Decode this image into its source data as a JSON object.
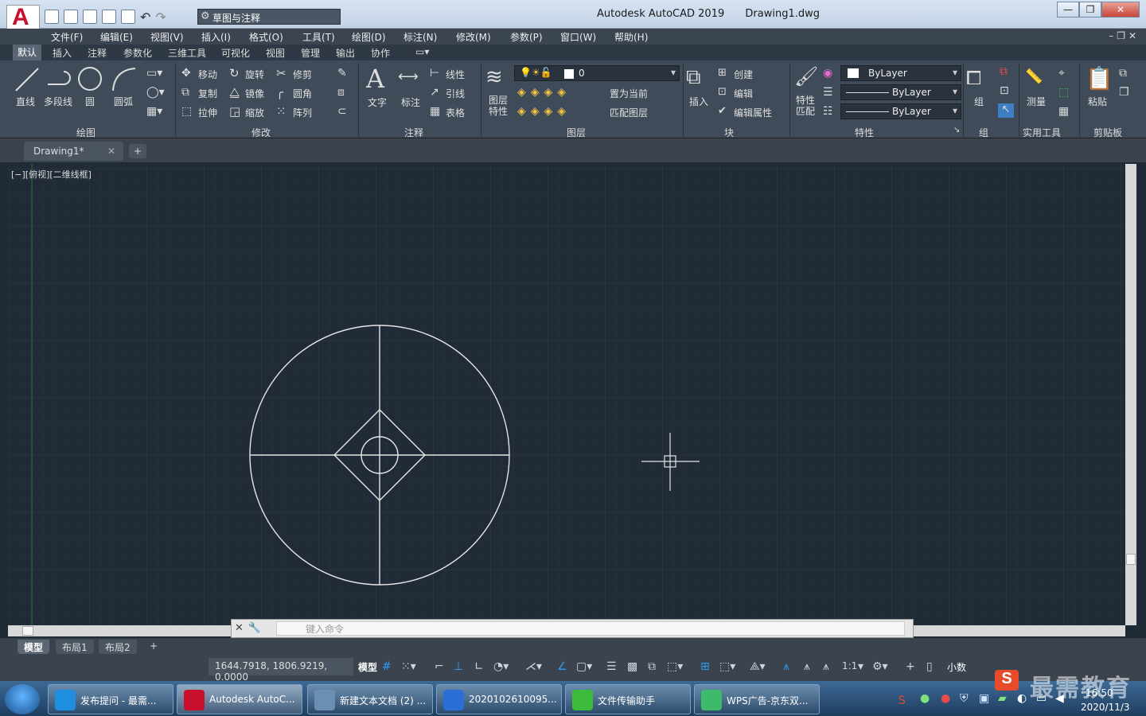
{
  "app": {
    "logo_letter": "A",
    "title": "Autodesk AutoCAD 2019",
    "document": "Drawing1.dwg",
    "workspace": "草图与注释"
  },
  "menu": [
    "文件(F)",
    "编辑(E)",
    "视图(V)",
    "插入(I)",
    "格式(O)",
    "工具(T)",
    "绘图(D)",
    "标注(N)",
    "修改(M)",
    "参数(P)",
    "窗口(W)",
    "帮助(H)"
  ],
  "ribbon_tabs": [
    "默认",
    "插入",
    "注释",
    "参数化",
    "三维工具",
    "可视化",
    "视图",
    "管理",
    "输出",
    "协作"
  ],
  "panels": {
    "draw": {
      "title": "绘图",
      "line": "直线",
      "polyline": "多段线",
      "circle": "圆",
      "arc": "圆弧"
    },
    "modify": {
      "title": "修改",
      "move": "移动",
      "rotate": "旋转",
      "trim": "修剪",
      "copy": "复制",
      "mirror": "镜像",
      "fillet": "圆角",
      "stretch": "拉伸",
      "scale": "缩放",
      "array": "阵列"
    },
    "annotation": {
      "title": "注释",
      "text": "文字",
      "dimension": "标注",
      "linear": "线性",
      "leader": "引线",
      "table": "表格"
    },
    "layers": {
      "title": "图层",
      "properties": "图层特性",
      "current_layer": "0",
      "set_current": "置为当前",
      "match": "匹配图层"
    },
    "block": {
      "title": "块",
      "insert": "插入",
      "create": "创建",
      "edit": "编辑",
      "edit_attr": "编辑属性"
    },
    "properties": {
      "title": "特性",
      "match": "特性匹配",
      "color": "ByLayer",
      "linetype": "ByLayer",
      "lineweight": "ByLayer"
    },
    "groups": {
      "title": "组",
      "group": "组"
    },
    "utilities": {
      "title": "实用工具",
      "measure": "测量"
    },
    "clipboard": {
      "title": "剪贴板",
      "paste": "粘贴"
    }
  },
  "file_tab": "Drawing1*",
  "viewport_label": "[−][俯视][二维线框]",
  "command_placeholder": "键入命令",
  "layout_tabs": [
    "模型",
    "布局1",
    "布局2"
  ],
  "status": {
    "coords": "1644.7918, 1806.9219, 0.0000",
    "model": "模型",
    "scale": "1:1",
    "units": "小数"
  },
  "taskbar": [
    {
      "label": "发布提问 - 最需...",
      "color": "#1e8fe0"
    },
    {
      "label": "Autodesk AutoC...",
      "color": "#c8102e",
      "active": true
    },
    {
      "label": "新建文本文档 (2) ...",
      "color": "#6b8fb3"
    },
    {
      "label": "2020102610095...",
      "color": "#2b6fd6"
    },
    {
      "label": "文件传输助手",
      "color": "#3dbb3d"
    },
    {
      "label": "WPS广告-京东双...",
      "color": "#3dbb6a"
    }
  ],
  "clock": {
    "time": "16:50",
    "date": "2020/11/3"
  },
  "watermark": "最需教育"
}
